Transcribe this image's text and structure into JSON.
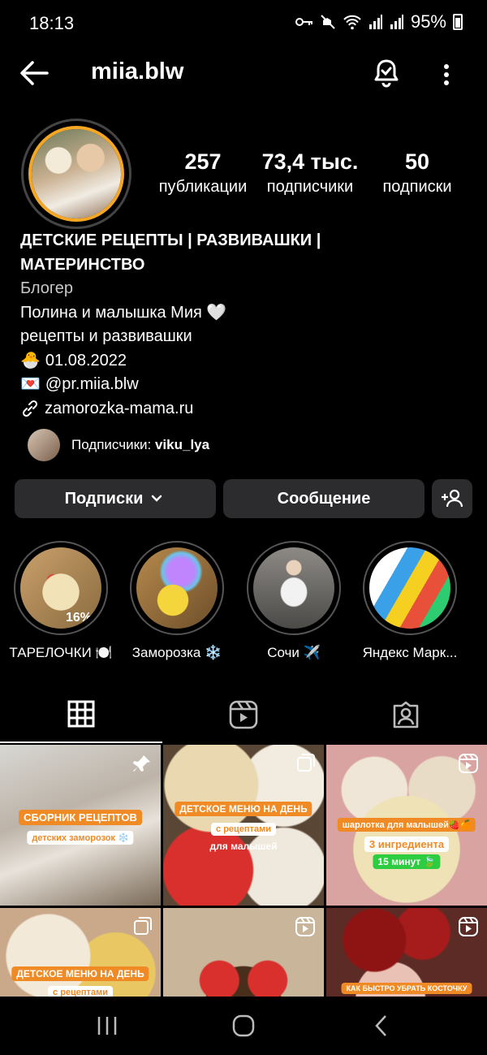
{
  "status": {
    "time": "18:13",
    "battery": "95%"
  },
  "header": {
    "username": "miia.blw"
  },
  "stats": [
    {
      "value": "257",
      "label": "публикации"
    },
    {
      "value": "73,4 тыс.",
      "label": "подписчики"
    },
    {
      "value": "50",
      "label": "подписки"
    }
  ],
  "bio": {
    "name_line1": "ДЕТСКИЕ РЕЦЕПТЫ | РАЗВИВАШКИ |",
    "name_line2": "МАТЕРИНСТВО",
    "category": "Блогер",
    "line1": "Полина и малышка Мия 🤍",
    "line2": "рецепты и развивашки",
    "birthday_emoji": "🐣",
    "birthday": "01.08.2022",
    "mail_emoji": "💌",
    "contact": "@pr.miia.blw",
    "link": "zamorozka-mama.ru"
  },
  "followed_by": {
    "prefix": "Подписчики: ",
    "user": "viku_lya"
  },
  "actions": {
    "following": "Подписки",
    "message": "Сообщение"
  },
  "highlights": [
    {
      "label": "ТАРЕЛОЧКИ 🍽️",
      "badge": "16%"
    },
    {
      "label": "Заморозка ❄️"
    },
    {
      "label": "Сочи ✈️"
    },
    {
      "label": "Яндекс Марк..."
    }
  ],
  "posts": {
    "p1": {
      "t1": "СБОРНИК РЕЦЕПТОВ",
      "t2": "детских заморозок ❄️"
    },
    "p2": {
      "t1": "ДЕТСКОЕ МЕНЮ НА ДЕНЬ",
      "t2": "с рецептами",
      "t3": "для малышей"
    },
    "p3": {
      "t1": "шарлотка для малышей🍓🍊",
      "t2": "3 ингредиента",
      "t3": "15 минут 🍃"
    },
    "p4": {
      "t1": "ДЕТСКОЕ МЕНЮ НА ДЕНЬ",
      "t2": "с рецептами"
    },
    "p6": {
      "t1": "КАК БЫСТРО УБРАТЬ КОСТОЧКУ"
    }
  },
  "colors": {
    "accent": "#f08a24",
    "ring": "#f5a623",
    "button_bg": "#2c2c2e"
  }
}
